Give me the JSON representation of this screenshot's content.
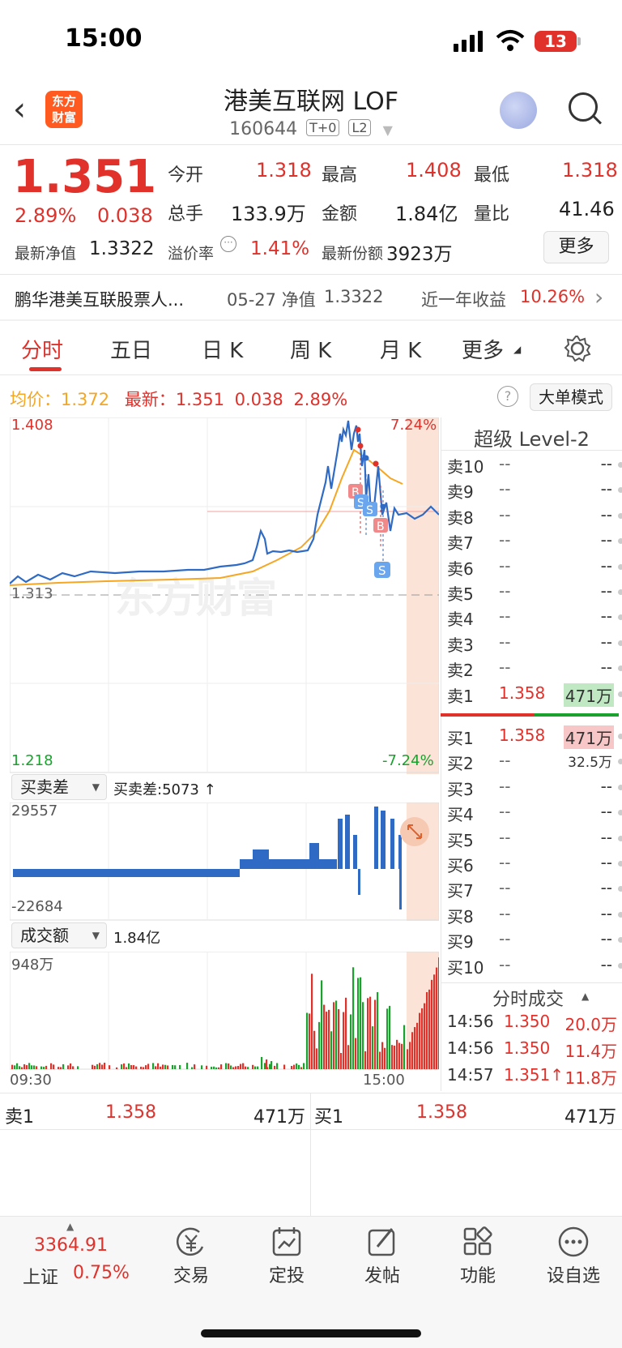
{
  "status": {
    "time": "15:00",
    "battery": "13"
  },
  "header": {
    "title": "港美互联网 LOF",
    "code": "160644",
    "tag1": "T+0",
    "tag2": "L2",
    "logo_line1": "东方",
    "logo_line2": "财富"
  },
  "quote": {
    "price": "1.351",
    "change_pct": "2.89%",
    "change": "0.038",
    "open_label": "今开",
    "open": "1.318",
    "high_label": "最高",
    "high": "1.408",
    "low_label": "最低",
    "low": "1.318",
    "vol_label": "总手",
    "vol": "133.9万",
    "amount_label": "金额",
    "amount": "1.84亿",
    "ratio_label": "量比",
    "ratio": "41.46",
    "nav_label": "最新净值",
    "nav": "1.3322",
    "premium_label": "溢价率",
    "premium": "1.41%",
    "shares_label": "最新份额",
    "shares": "3923万",
    "more": "更多"
  },
  "fund_row": {
    "name": "鹏华港美互联股票人...",
    "date_nav": "05-27 净值",
    "nav": "1.3322",
    "year_label": "近一年收益",
    "year_ret": "10.26%"
  },
  "tabs": [
    "分时",
    "五日",
    "日 K",
    "周 K",
    "月 K",
    "更多"
  ],
  "chart_header": {
    "avg_label": "均价：",
    "avg": "1.372",
    "latest_label": "最新：",
    "latest": "1.351",
    "chg": "0.038",
    "pct": "2.89%",
    "big_mode": "大单模式"
  },
  "chart": {
    "ymax": "1.408",
    "ymax_pct": "7.24%",
    "ymin": "1.218",
    "ymin_pct": "-7.24%",
    "ref": "1.313",
    "watermark": "东方财富",
    "diff_select": "买卖差",
    "diff_value": "买卖差:5073 ↑",
    "diff_max": "29557",
    "diff_min": "-22684",
    "amt_select": "成交额",
    "amt_value": "1.84亿",
    "amt_max": "948万",
    "time_start": "09:30",
    "time_end": "15:00"
  },
  "level2": {
    "title": "超级 Level-2",
    "asks": [
      {
        "label": "卖10",
        "price": "--",
        "vol": "--"
      },
      {
        "label": "卖9",
        "price": "--",
        "vol": "--"
      },
      {
        "label": "卖8",
        "price": "--",
        "vol": "--"
      },
      {
        "label": "卖7",
        "price": "--",
        "vol": "--"
      },
      {
        "label": "卖6",
        "price": "--",
        "vol": "--"
      },
      {
        "label": "卖5",
        "price": "--",
        "vol": "--"
      },
      {
        "label": "卖4",
        "price": "--",
        "vol": "--"
      },
      {
        "label": "卖3",
        "price": "--",
        "vol": "--"
      },
      {
        "label": "卖2",
        "price": "--",
        "vol": "--"
      },
      {
        "label": "卖1",
        "price": "1.358",
        "vol": "471万"
      }
    ],
    "bids": [
      {
        "label": "买1",
        "price": "1.358",
        "vol": "471万"
      },
      {
        "label": "买2",
        "price": "--",
        "vol": "32.5万"
      },
      {
        "label": "买3",
        "price": "--",
        "vol": "--"
      },
      {
        "label": "买4",
        "price": "--",
        "vol": "--"
      },
      {
        "label": "买5",
        "price": "--",
        "vol": "--"
      },
      {
        "label": "买6",
        "price": "--",
        "vol": "--"
      },
      {
        "label": "买7",
        "price": "--",
        "vol": "--"
      },
      {
        "label": "买8",
        "price": "--",
        "vol": "--"
      },
      {
        "label": "买9",
        "price": "--",
        "vol": "--"
      },
      {
        "label": "买10",
        "price": "--",
        "vol": "--"
      }
    ],
    "ticks_title": "分时成交",
    "ticks": [
      {
        "time": "14:56",
        "price": "1.350",
        "vol": "20.0万"
      },
      {
        "time": "14:56",
        "price": "1.350",
        "vol": "11.4万"
      },
      {
        "time": "14:57",
        "price": "1.351↑",
        "vol": "11.8万"
      }
    ]
  },
  "bottom_quote": {
    "sell_label": "卖1",
    "sell_price": "1.358",
    "sell_vol": "471万",
    "buy_label": "买1",
    "buy_price": "1.358",
    "buy_vol": "471万"
  },
  "tabbar": {
    "index_value": "3364.91",
    "index_name": "上证",
    "index_pct": "0.75%",
    "items": [
      "交易",
      "定投",
      "发帖",
      "功能",
      "设自选"
    ]
  }
}
